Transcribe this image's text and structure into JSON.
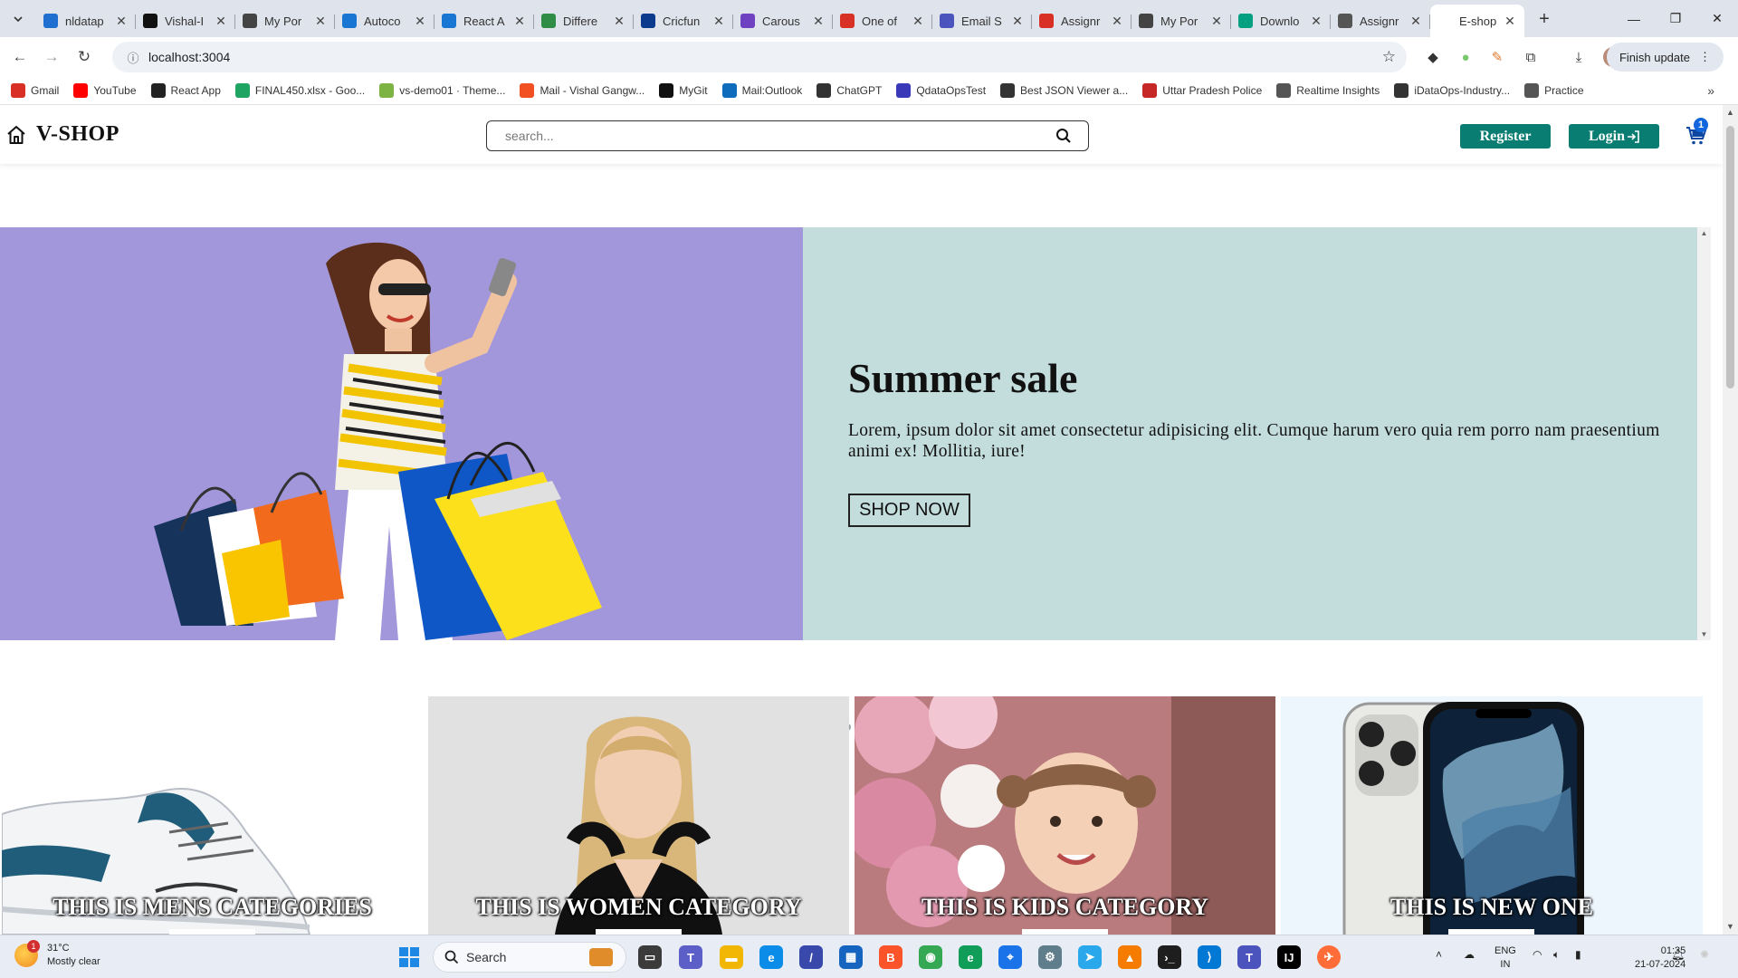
{
  "browser": {
    "tabs": [
      {
        "title": "nldatap",
        "icon": "vscode-icon",
        "color": "#1f6fd1"
      },
      {
        "title": "Vishal-I",
        "icon": "github-icon",
        "color": "#111111"
      },
      {
        "title": "My Por",
        "icon": "globe-icon",
        "color": "#444444"
      },
      {
        "title": "Autoco",
        "icon": "mui-icon",
        "color": "#1976d2"
      },
      {
        "title": "React A",
        "icon": "mui-icon",
        "color": "#1976d2"
      },
      {
        "title": "Differe",
        "icon": "gfg-icon",
        "color": "#2f8d46"
      },
      {
        "title": "Cricfun",
        "icon": "cricfun-icon",
        "color": "#0b3b8c"
      },
      {
        "title": "Carous",
        "icon": "bootstrap-icon",
        "color": "#6f42c1"
      },
      {
        "title": "One of",
        "icon": "gmail-icon",
        "color": "#d93025"
      },
      {
        "title": "Email S",
        "icon": "teams-icon",
        "color": "#4b53bc"
      },
      {
        "title": "Assignr",
        "icon": "gmail-icon",
        "color": "#d93025"
      },
      {
        "title": "My Por",
        "icon": "globe-icon",
        "color": "#444444"
      },
      {
        "title": "Downlo",
        "icon": "pexels-icon",
        "color": "#05a081"
      },
      {
        "title": "Assignr",
        "icon": "dash-icon",
        "color": "#555555"
      }
    ],
    "active_tab": "E-shop",
    "url": "localhost:3004",
    "finish_update": "Finish update",
    "bookmarks": [
      {
        "label": "Gmail",
        "icon": "gmail-icon",
        "color": "#d93025"
      },
      {
        "label": "YouTube",
        "icon": "youtube-icon",
        "color": "#ff0000"
      },
      {
        "label": "React App",
        "icon": "react-icon",
        "color": "#222222"
      },
      {
        "label": "FINAL450.xlsx - Goo...",
        "icon": "drive-icon",
        "color": "#1fa463"
      },
      {
        "label": "vs-demo01 · Theme...",
        "icon": "theme-icon",
        "color": "#7cb342"
      },
      {
        "label": "Mail - Vishal Gangw...",
        "icon": "microsoft-icon",
        "color": "#f25022"
      },
      {
        "label": "MyGit",
        "icon": "github-icon",
        "color": "#111111"
      },
      {
        "label": "Mail:Outlook",
        "icon": "outlook-icon",
        "color": "#0f6cbd"
      },
      {
        "label": "ChatGPT",
        "icon": "openai-icon",
        "color": "#333333"
      },
      {
        "label": "QdataOpsTest",
        "icon": "qdata-icon",
        "color": "#3a3ab8"
      },
      {
        "label": "Best JSON Viewer a...",
        "icon": "cb-icon",
        "color": "#333333"
      },
      {
        "label": "Uttar Pradesh Police",
        "icon": "police-icon",
        "color": "#c62828"
      },
      {
        "label": "Realtime Insights",
        "icon": "dash-icon",
        "color": "#555555"
      },
      {
        "label": "iDataOps-Industry...",
        "icon": "idataops-icon",
        "color": "#333333"
      },
      {
        "label": "Practice",
        "icon": "practice-icon",
        "color": "#555555"
      }
    ]
  },
  "site": {
    "brand": "V-SHOP",
    "search_placeholder": "search...",
    "register": "Register",
    "login": "Login",
    "login_icon": "login-arrow-icon",
    "cart_count": "1",
    "accent": "#097d72"
  },
  "hero": {
    "title": "Summer sale",
    "text": "Lorem, ipsum dolor sit amet consectetur adipisicing elit. Cumque harum vero quia rem porro nam praesentium animi ex! Mollitia, iure!",
    "cta": "SHOP NOW",
    "slides": 3,
    "active_slide": 1,
    "image_bg": "#a397dc",
    "text_bg": "#c3dcdc"
  },
  "categories": [
    {
      "label": "THIS IS MENS CATEGORIES"
    },
    {
      "label": "THIS IS WOMEN CATEGORY"
    },
    {
      "label": "THIS IS KIDS CATEGORY"
    },
    {
      "label": "THIS IS NEW ONE"
    }
  ],
  "taskbar": {
    "temperature": "31°C",
    "weather": "Mostly clear",
    "weather_badge": "1",
    "search": "Search",
    "lang_top": "ENG",
    "lang_bottom": "IN",
    "time": "01:35",
    "date": "21-07-2024"
  }
}
